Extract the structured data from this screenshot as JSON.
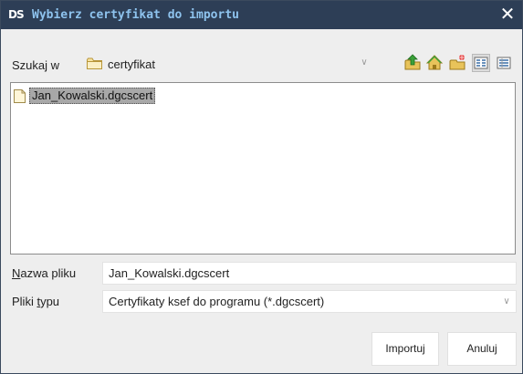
{
  "window": {
    "logo": "DS",
    "title": "Wybierz certyfikat do importu",
    "close_symbol": "✕"
  },
  "lookin": {
    "label": "Szukaj w",
    "value": "certyfikat"
  },
  "toolbar": [
    {
      "name": "up-folder-icon"
    },
    {
      "name": "home-icon"
    },
    {
      "name": "new-folder-icon"
    },
    {
      "name": "list-view-icon",
      "pressed": true
    },
    {
      "name": "details-view-icon"
    }
  ],
  "files": [
    {
      "name": "Jan_Kowalski.dgcscert",
      "selected": true
    }
  ],
  "filename": {
    "label_first": "N",
    "label_rest": "azwa pliku",
    "value": "Jan_Kowalski.dgcscert"
  },
  "filetype": {
    "label_first": "Pliki ",
    "label_underlined": "t",
    "label_rest": "ypu",
    "value": "Certyfikaty ksef do programu (*.dgcscert)"
  },
  "buttons": {
    "import": "Importuj",
    "cancel": "Anuluj"
  },
  "colors": {
    "titlebar": "#2d3e56",
    "title_text": "#8ec3ee",
    "selection": "#a8a8a8"
  }
}
